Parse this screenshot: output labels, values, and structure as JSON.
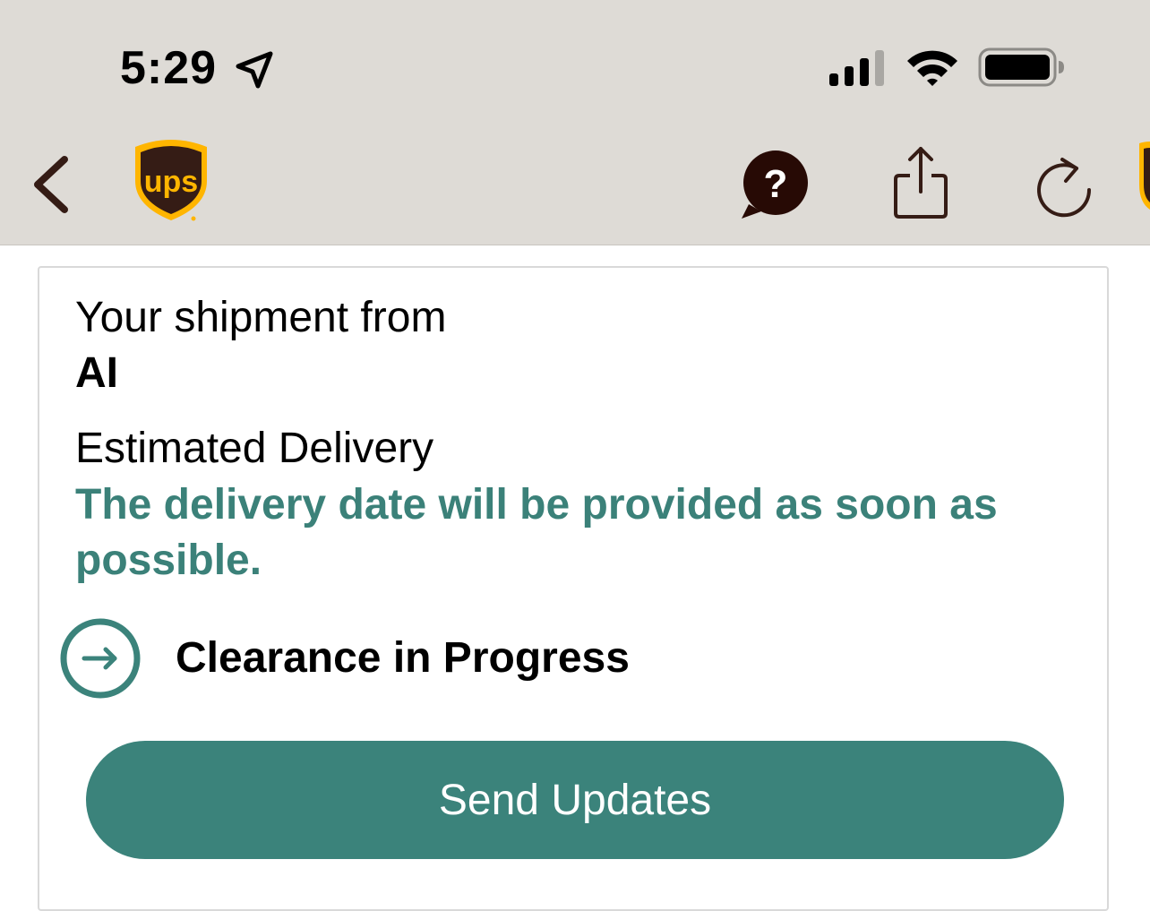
{
  "status_bar": {
    "time": "5:29",
    "icons": [
      "location-arrow-icon",
      "cellular-signal-icon",
      "wifi-icon",
      "battery-icon"
    ]
  },
  "nav": {
    "icons": [
      "chevron-left-icon",
      "ups-logo",
      "help-icon",
      "share-icon",
      "refresh-icon"
    ]
  },
  "shipment": {
    "label": "Your shipment from",
    "from": "AI",
    "estimated_label": "Estimated Delivery",
    "estimated_value": "The delivery date will be provided as soon as possible.",
    "status": "Clearance in Progress",
    "status_icon": "arrow-right-circle-icon"
  },
  "actions": {
    "send_updates_label": "Send Updates"
  },
  "colors": {
    "header_background": "#dedbd6",
    "accent_teal": "#3b837b",
    "ups_brown": "#351c15",
    "ups_gold": "#ffb500"
  }
}
